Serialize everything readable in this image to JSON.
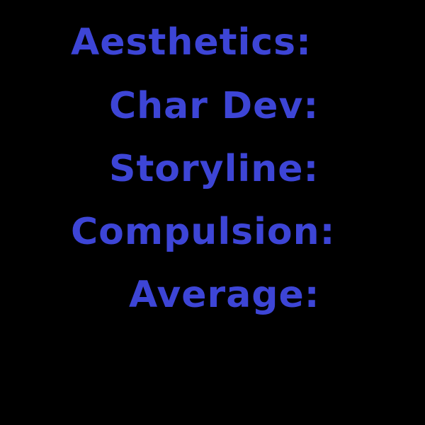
{
  "accent_color": "#3d45d6",
  "background_color": "#000000",
  "rating_labels": [
    "Aesthetics:",
    "Char Dev:",
    "Storyline:",
    "Compulsion:",
    "Average:"
  ]
}
